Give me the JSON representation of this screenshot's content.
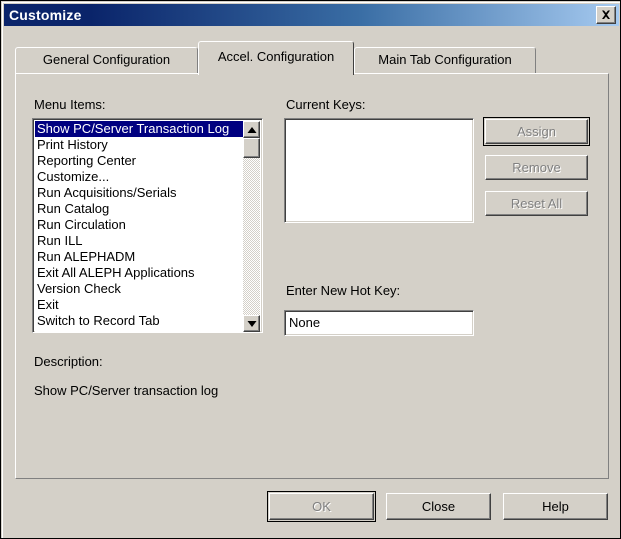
{
  "window": {
    "title": "Customize",
    "close_icon": "close-icon"
  },
  "tabs": [
    {
      "label": "General Configuration",
      "active": false
    },
    {
      "label": "Accel. Configuration",
      "active": true
    },
    {
      "label": "Main Tab Configuration",
      "active": false
    }
  ],
  "menu_items": {
    "label": "Menu Items:",
    "selected_index": 0,
    "items": [
      "Show PC/Server Transaction Log",
      "Print History",
      "Reporting Center",
      "Customize...",
      "Run Acquisitions/Serials",
      "Run Catalog",
      "Run Circulation",
      "Run ILL",
      "Run ALEPHADM",
      "Exit All ALEPH Applications",
      "Version Check",
      "Exit",
      "Switch to Record Tab"
    ],
    "scrollbar": {
      "up_icon": "scroll-up-arrow-icon",
      "down_icon": "scroll-down-arrow-icon"
    }
  },
  "current_keys": {
    "label": "Current Keys:",
    "items": []
  },
  "key_buttons": [
    {
      "label": "Assign",
      "enabled": false,
      "default": true
    },
    {
      "label": "Remove",
      "enabled": false,
      "default": false
    },
    {
      "label": "Reset All",
      "enabled": false,
      "default": false
    }
  ],
  "hotkey": {
    "label": "Enter New Hot Key:",
    "value": "None",
    "placeholder": ""
  },
  "description": {
    "label": "Description:",
    "text": "Show PC/Server transaction log"
  },
  "dialog_buttons": [
    {
      "label": "OK",
      "enabled": false,
      "default": true
    },
    {
      "label": "Close",
      "enabled": true,
      "default": false
    },
    {
      "label": "Help",
      "enabled": true,
      "default": false
    }
  ],
  "colors": {
    "face": "#d4d0c8",
    "title_start": "#0a246a",
    "title_end": "#a6caf0",
    "highlight": "#000080",
    "highlight_text": "#ffffff",
    "disabled_text": "#808080"
  }
}
